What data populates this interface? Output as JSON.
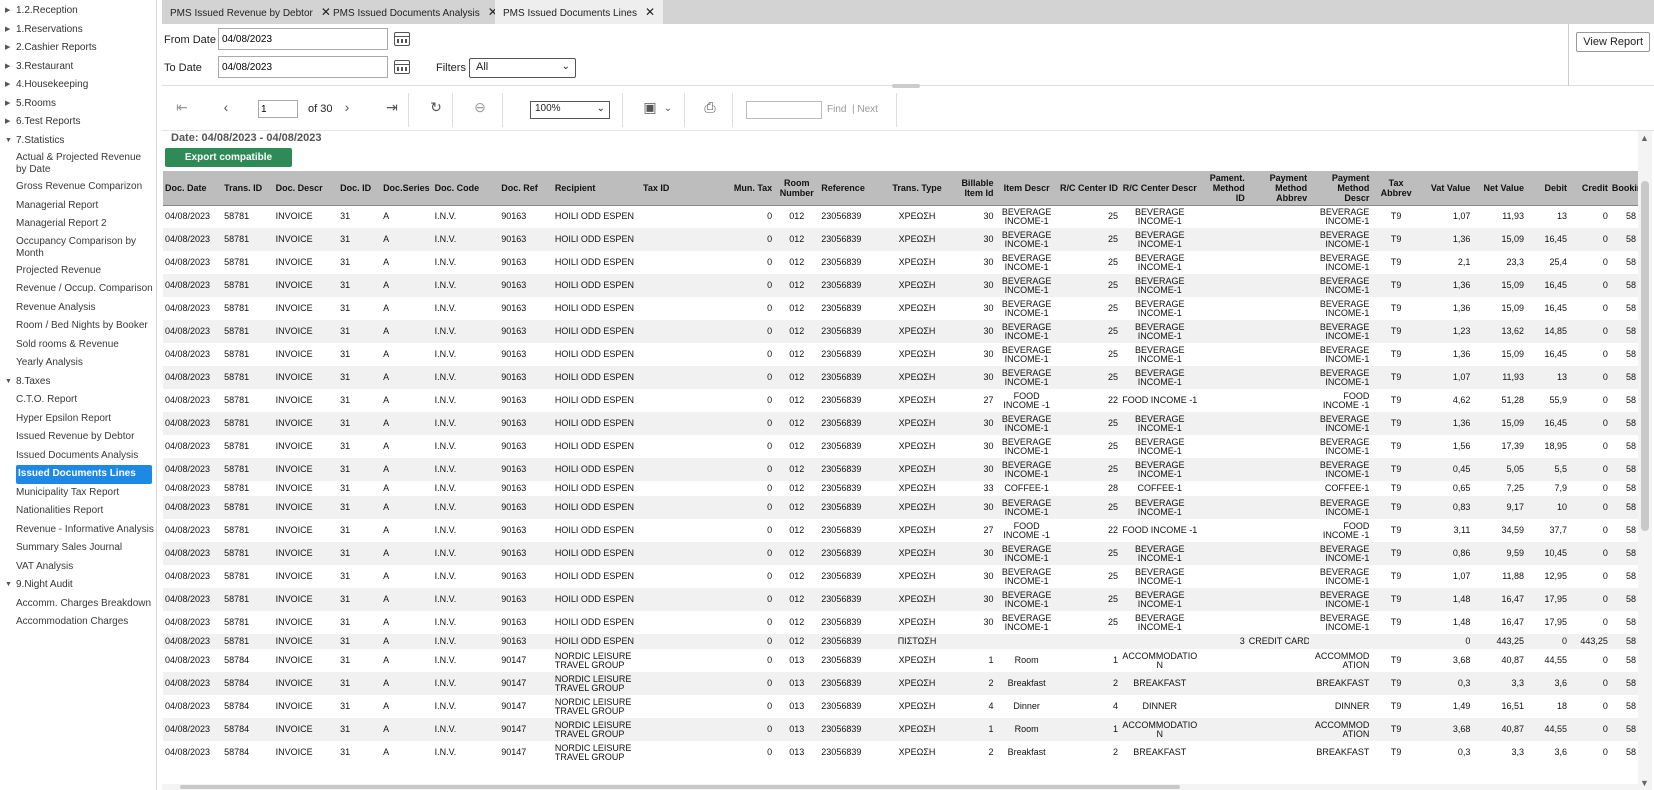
{
  "sidebar": {
    "items": [
      {
        "label": "1.2.Reception",
        "kind": "group",
        "state": "collapsed"
      },
      {
        "label": "1.Reservations",
        "kind": "group",
        "state": "collapsed"
      },
      {
        "label": "2.Cashier Reports",
        "kind": "group",
        "state": "collapsed"
      },
      {
        "label": "3.Restaurant",
        "kind": "group",
        "state": "collapsed"
      },
      {
        "label": "4.Housekeeping",
        "kind": "group",
        "state": "collapsed"
      },
      {
        "label": "5.Rooms",
        "kind": "group",
        "state": "collapsed"
      },
      {
        "label": "6.Test Reports",
        "kind": "group",
        "state": "collapsed"
      },
      {
        "label": "7.Statistics",
        "kind": "group",
        "state": "expanded"
      },
      {
        "label": "Actual & Projected Revenue by Date",
        "kind": "leaf2"
      },
      {
        "label": "Gross Revenue Comparizon",
        "kind": "leaf"
      },
      {
        "label": "Managerial Report",
        "kind": "leaf"
      },
      {
        "label": "Managerial Report 2",
        "kind": "leaf"
      },
      {
        "label": "Occupancy Comparison by Month",
        "kind": "leaf2"
      },
      {
        "label": "Projected Revenue",
        "kind": "leaf"
      },
      {
        "label": "Revenue / Occup. Comparison",
        "kind": "leaf"
      },
      {
        "label": "Revenue Analysis",
        "kind": "leaf"
      },
      {
        "label": "Room / Bed Nights by Booker",
        "kind": "leaf"
      },
      {
        "label": "Sold rooms & Revenue",
        "kind": "leaf"
      },
      {
        "label": "Yearly Analysis",
        "kind": "leaf"
      },
      {
        "label": "8.Taxes",
        "kind": "group",
        "state": "expanded"
      },
      {
        "label": "C.T.O. Report",
        "kind": "leaf"
      },
      {
        "label": "Hyper Epsilon Report",
        "kind": "leaf"
      },
      {
        "label": "Issued Revenue by Debtor",
        "kind": "leaf"
      },
      {
        "label": "Issued Documents Analysis",
        "kind": "leaf"
      },
      {
        "label": "Issued Documents Lines",
        "kind": "leaf",
        "active": true
      },
      {
        "label": "Municipality Tax Report",
        "kind": "leaf"
      },
      {
        "label": "Nationalities Report",
        "kind": "leaf"
      },
      {
        "label": "Revenue - Informative Analysis",
        "kind": "leaf"
      },
      {
        "label": "Summary Sales Journal",
        "kind": "leaf"
      },
      {
        "label": "VAT Analysis",
        "kind": "leaf"
      },
      {
        "label": "9.Night Audit",
        "kind": "group",
        "state": "expanded"
      },
      {
        "label": "Accomm. Charges Breakdown",
        "kind": "leaf"
      },
      {
        "label": "Accommodation Charges",
        "kind": "leaf"
      }
    ]
  },
  "tabs": [
    {
      "label": "PMS Issued Revenue by Debtor",
      "active": false
    },
    {
      "label": "PMS Issued Documents Analysis",
      "active": false
    },
    {
      "label": "PMS Issued Documents Lines",
      "active": true
    }
  ],
  "params": {
    "from_label": "From Date",
    "from_value": "04/08/2023",
    "to_label": "To Date",
    "to_value": "04/08/2023",
    "filters_label": "Filters",
    "filters_value": "All",
    "view_report": "View Report"
  },
  "toolbar": {
    "page": "1",
    "of_pages": "of 30",
    "zoom": "100%",
    "find_label": "Find",
    "next_label": "| Next"
  },
  "report": {
    "date_range": "Date: 04/08/2023 - 04/08/2023",
    "export_label": "Export compatible",
    "columns": [
      "Doc. Date",
      "Trans. ID",
      "Doc. Descr",
      "Doc. ID",
      "Doc.Series",
      "Doc. Code",
      "Doc. Ref",
      "Recipient",
      "Tax ID",
      "Mun. Tax",
      "Room Number",
      "Reference",
      "Trans. Type",
      "Billable Item Id",
      "Item Descr",
      "R/C Center ID",
      "R/C Center Descr",
      "Pament. Method ID",
      "Payment Method Abbrev",
      "Payment Method Descr",
      "Tax Abbrev",
      "Vat Value",
      "Net Value",
      "Debit",
      "Credit",
      "Booking"
    ],
    "rows": [
      [
        "04/08/2023",
        "58781",
        "INVOICE",
        "31",
        "A",
        "I.N.V.",
        "90163",
        "HOILI ODD ESPEN",
        "",
        "0",
        "012",
        "23056839",
        "ΧΡΕΩΣΗ",
        "30",
        "BEVERAGE INCOME-1",
        "25",
        "BEVERAGE INCOME-1",
        "",
        "",
        "BEVERAGE INCOME-1",
        "T9",
        "1,07",
        "11,93",
        "13",
        "0",
        "58"
      ],
      [
        "04/08/2023",
        "58781",
        "INVOICE",
        "31",
        "A",
        "I.N.V.",
        "90163",
        "HOILI ODD ESPEN",
        "",
        "0",
        "012",
        "23056839",
        "ΧΡΕΩΣΗ",
        "30",
        "BEVERAGE INCOME-1",
        "25",
        "BEVERAGE INCOME-1",
        "",
        "",
        "BEVERAGE INCOME-1",
        "T9",
        "1,36",
        "15,09",
        "16,45",
        "0",
        "58"
      ],
      [
        "04/08/2023",
        "58781",
        "INVOICE",
        "31",
        "A",
        "I.N.V.",
        "90163",
        "HOILI ODD ESPEN",
        "",
        "0",
        "012",
        "23056839",
        "ΧΡΕΩΣΗ",
        "30",
        "BEVERAGE INCOME-1",
        "25",
        "BEVERAGE INCOME-1",
        "",
        "",
        "BEVERAGE INCOME-1",
        "T9",
        "2,1",
        "23,3",
        "25,4",
        "0",
        "58"
      ],
      [
        "04/08/2023",
        "58781",
        "INVOICE",
        "31",
        "A",
        "I.N.V.",
        "90163",
        "HOILI ODD ESPEN",
        "",
        "0",
        "012",
        "23056839",
        "ΧΡΕΩΣΗ",
        "30",
        "BEVERAGE INCOME-1",
        "25",
        "BEVERAGE INCOME-1",
        "",
        "",
        "BEVERAGE INCOME-1",
        "T9",
        "1,36",
        "15,09",
        "16,45",
        "0",
        "58"
      ],
      [
        "04/08/2023",
        "58781",
        "INVOICE",
        "31",
        "A",
        "I.N.V.",
        "90163",
        "HOILI ODD ESPEN",
        "",
        "0",
        "012",
        "23056839",
        "ΧΡΕΩΣΗ",
        "30",
        "BEVERAGE INCOME-1",
        "25",
        "BEVERAGE INCOME-1",
        "",
        "",
        "BEVERAGE INCOME-1",
        "T9",
        "1,36",
        "15,09",
        "16,45",
        "0",
        "58"
      ],
      [
        "04/08/2023",
        "58781",
        "INVOICE",
        "31",
        "A",
        "I.N.V.",
        "90163",
        "HOILI ODD ESPEN",
        "",
        "0",
        "012",
        "23056839",
        "ΧΡΕΩΣΗ",
        "30",
        "BEVERAGE INCOME-1",
        "25",
        "BEVERAGE INCOME-1",
        "",
        "",
        "BEVERAGE INCOME-1",
        "T9",
        "1,23",
        "13,62",
        "14,85",
        "0",
        "58"
      ],
      [
        "04/08/2023",
        "58781",
        "INVOICE",
        "31",
        "A",
        "I.N.V.",
        "90163",
        "HOILI ODD ESPEN",
        "",
        "0",
        "012",
        "23056839",
        "ΧΡΕΩΣΗ",
        "30",
        "BEVERAGE INCOME-1",
        "25",
        "BEVERAGE INCOME-1",
        "",
        "",
        "BEVERAGE INCOME-1",
        "T9",
        "1,36",
        "15,09",
        "16,45",
        "0",
        "58"
      ],
      [
        "04/08/2023",
        "58781",
        "INVOICE",
        "31",
        "A",
        "I.N.V.",
        "90163",
        "HOILI ODD ESPEN",
        "",
        "0",
        "012",
        "23056839",
        "ΧΡΕΩΣΗ",
        "30",
        "BEVERAGE INCOME-1",
        "25",
        "BEVERAGE INCOME-1",
        "",
        "",
        "BEVERAGE INCOME-1",
        "T9",
        "1,07",
        "11,93",
        "13",
        "0",
        "58"
      ],
      [
        "04/08/2023",
        "58781",
        "INVOICE",
        "31",
        "A",
        "I.N.V.",
        "90163",
        "HOILI ODD ESPEN",
        "",
        "0",
        "012",
        "23056839",
        "ΧΡΕΩΣΗ",
        "27",
        "FOOD INCOME -1",
        "22",
        "FOOD INCOME -1",
        "",
        "",
        "FOOD INCOME -1",
        "T9",
        "4,62",
        "51,28",
        "55,9",
        "0",
        "58"
      ],
      [
        "04/08/2023",
        "58781",
        "INVOICE",
        "31",
        "A",
        "I.N.V.",
        "90163",
        "HOILI ODD ESPEN",
        "",
        "0",
        "012",
        "23056839",
        "ΧΡΕΩΣΗ",
        "30",
        "BEVERAGE INCOME-1",
        "25",
        "BEVERAGE INCOME-1",
        "",
        "",
        "BEVERAGE INCOME-1",
        "T9",
        "1,36",
        "15,09",
        "16,45",
        "0",
        "58"
      ],
      [
        "04/08/2023",
        "58781",
        "INVOICE",
        "31",
        "A",
        "I.N.V.",
        "90163",
        "HOILI ODD ESPEN",
        "",
        "0",
        "012",
        "23056839",
        "ΧΡΕΩΣΗ",
        "30",
        "BEVERAGE INCOME-1",
        "25",
        "BEVERAGE INCOME-1",
        "",
        "",
        "BEVERAGE INCOME-1",
        "T9",
        "1,56",
        "17,39",
        "18,95",
        "0",
        "58"
      ],
      [
        "04/08/2023",
        "58781",
        "INVOICE",
        "31",
        "A",
        "I.N.V.",
        "90163",
        "HOILI ODD ESPEN",
        "",
        "0",
        "012",
        "23056839",
        "ΧΡΕΩΣΗ",
        "30",
        "BEVERAGE INCOME-1",
        "25",
        "BEVERAGE INCOME-1",
        "",
        "",
        "BEVERAGE INCOME-1",
        "T9",
        "0,45",
        "5,05",
        "5,5",
        "0",
        "58"
      ],
      [
        "04/08/2023",
        "58781",
        "INVOICE",
        "31",
        "A",
        "I.N.V.",
        "90163",
        "HOILI ODD ESPEN",
        "",
        "0",
        "012",
        "23056839",
        "ΧΡΕΩΣΗ",
        "33",
        "COFFEE-1",
        "28",
        "COFFEE-1",
        "",
        "",
        "COFFEE-1",
        "T9",
        "0,65",
        "7,25",
        "7,9",
        "0",
        "58"
      ],
      [
        "04/08/2023",
        "58781",
        "INVOICE",
        "31",
        "A",
        "I.N.V.",
        "90163",
        "HOILI ODD ESPEN",
        "",
        "0",
        "012",
        "23056839",
        "ΧΡΕΩΣΗ",
        "30",
        "BEVERAGE INCOME-1",
        "25",
        "BEVERAGE INCOME-1",
        "",
        "",
        "BEVERAGE INCOME-1",
        "T9",
        "0,83",
        "9,17",
        "10",
        "0",
        "58"
      ],
      [
        "04/08/2023",
        "58781",
        "INVOICE",
        "31",
        "A",
        "I.N.V.",
        "90163",
        "HOILI ODD ESPEN",
        "",
        "0",
        "012",
        "23056839",
        "ΧΡΕΩΣΗ",
        "27",
        "FOOD INCOME -1",
        "22",
        "FOOD INCOME -1",
        "",
        "",
        "FOOD INCOME -1",
        "T9",
        "3,11",
        "34,59",
        "37,7",
        "0",
        "58"
      ],
      [
        "04/08/2023",
        "58781",
        "INVOICE",
        "31",
        "A",
        "I.N.V.",
        "90163",
        "HOILI ODD ESPEN",
        "",
        "0",
        "012",
        "23056839",
        "ΧΡΕΩΣΗ",
        "30",
        "BEVERAGE INCOME-1",
        "25",
        "BEVERAGE INCOME-1",
        "",
        "",
        "BEVERAGE INCOME-1",
        "T9",
        "0,86",
        "9,59",
        "10,45",
        "0",
        "58"
      ],
      [
        "04/08/2023",
        "58781",
        "INVOICE",
        "31",
        "A",
        "I.N.V.",
        "90163",
        "HOILI ODD ESPEN",
        "",
        "0",
        "012",
        "23056839",
        "ΧΡΕΩΣΗ",
        "30",
        "BEVERAGE INCOME-1",
        "25",
        "BEVERAGE INCOME-1",
        "",
        "",
        "BEVERAGE INCOME-1",
        "T9",
        "1,07",
        "11,88",
        "12,95",
        "0",
        "58"
      ],
      [
        "04/08/2023",
        "58781",
        "INVOICE",
        "31",
        "A",
        "I.N.V.",
        "90163",
        "HOILI ODD ESPEN",
        "",
        "0",
        "012",
        "23056839",
        "ΧΡΕΩΣΗ",
        "30",
        "BEVERAGE INCOME-1",
        "25",
        "BEVERAGE INCOME-1",
        "",
        "",
        "BEVERAGE INCOME-1",
        "T9",
        "1,48",
        "16,47",
        "17,95",
        "0",
        "58"
      ],
      [
        "04/08/2023",
        "58781",
        "INVOICE",
        "31",
        "A",
        "I.N.V.",
        "90163",
        "HOILI ODD ESPEN",
        "",
        "0",
        "012",
        "23056839",
        "ΧΡΕΩΣΗ",
        "30",
        "BEVERAGE INCOME-1",
        "25",
        "BEVERAGE INCOME-1",
        "",
        "",
        "BEVERAGE INCOME-1",
        "T9",
        "1,48",
        "16,47",
        "17,95",
        "0",
        "58"
      ],
      [
        "04/08/2023",
        "58781",
        "INVOICE",
        "31",
        "A",
        "I.N.V.",
        "90163",
        "HOILI ODD ESPEN",
        "",
        "0",
        "012",
        "23056839",
        "ΠΙΣΤΩΣΗ",
        "",
        "",
        "",
        "",
        "3",
        "CREDIT CARD",
        "",
        "",
        "0",
        "443,25",
        "0",
        "443,25",
        "58"
      ],
      [
        "04/08/2023",
        "58784",
        "INVOICE",
        "31",
        "A",
        "I.N.V.",
        "90147",
        "NORDIC LEISURE TRAVEL GROUP",
        "",
        "0",
        "013",
        "23056839",
        "ΧΡΕΩΣΗ",
        "1",
        "Room",
        "1",
        "ACCOMMODATIO N",
        "",
        "",
        "ACCOMMOD ATION",
        "T9",
        "3,68",
        "40,87",
        "44,55",
        "0",
        "58"
      ],
      [
        "04/08/2023",
        "58784",
        "INVOICE",
        "31",
        "A",
        "I.N.V.",
        "90147",
        "NORDIC LEISURE TRAVEL GROUP",
        "",
        "0",
        "013",
        "23056839",
        "ΧΡΕΩΣΗ",
        "2",
        "Breakfast",
        "2",
        "BREAKFAST",
        "",
        "",
        "BREAKFAST",
        "T9",
        "0,3",
        "3,3",
        "3,6",
        "0",
        "58"
      ],
      [
        "04/08/2023",
        "58784",
        "INVOICE",
        "31",
        "A",
        "I.N.V.",
        "90147",
        "NORDIC LEISURE TRAVEL GROUP",
        "",
        "0",
        "013",
        "23056839",
        "ΧΡΕΩΣΗ",
        "4",
        "Dinner",
        "4",
        "DINNER",
        "",
        "",
        "DINNER",
        "T9",
        "1,49",
        "16,51",
        "18",
        "0",
        "58"
      ],
      [
        "04/08/2023",
        "58784",
        "INVOICE",
        "31",
        "A",
        "I.N.V.",
        "90147",
        "NORDIC LEISURE TRAVEL GROUP",
        "",
        "0",
        "013",
        "23056839",
        "ΧΡΕΩΣΗ",
        "1",
        "Room",
        "1",
        "ACCOMMODATIO N",
        "",
        "",
        "ACCOMMOD ATION",
        "T9",
        "3,68",
        "40,87",
        "44,55",
        "0",
        "58"
      ],
      [
        "04/08/2023",
        "58784",
        "INVOICE",
        "31",
        "A",
        "I.N.V.",
        "90147",
        "NORDIC LEISURE TRAVEL GROUP",
        "",
        "0",
        "013",
        "23056839",
        "ΧΡΕΩΣΗ",
        "2",
        "Breakfast",
        "2",
        "BREAKFAST",
        "",
        "",
        "BREAKFAST",
        "T9",
        "0,3",
        "3,3",
        "3,6",
        "0",
        "58"
      ]
    ]
  },
  "colors": {
    "active_nav": "#1e88e5",
    "export_button": "#2e8b57",
    "header_bg": "#bdbdbd",
    "tabbar_bg": "#d3d3d3"
  }
}
